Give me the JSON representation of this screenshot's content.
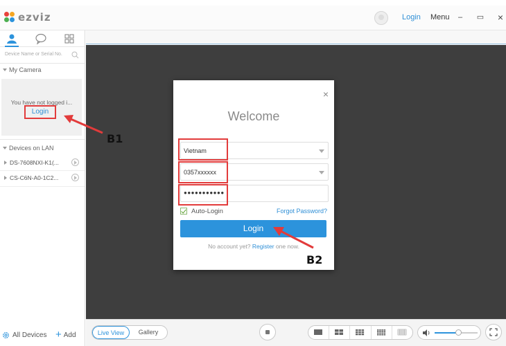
{
  "window": {
    "logo_text": "ezviz",
    "login_label": "Login",
    "menu_label": "Menu",
    "minimize": "–",
    "maximize": "▭",
    "close": "×"
  },
  "sidebar": {
    "search_placeholder": "Device Name or Serial No.",
    "my_camera_label": "My Camera",
    "not_logged_text": "You have not logged i...",
    "login_label": "Login",
    "lan_label": "Devices on LAN",
    "devices": [
      {
        "name": "DS-7608NXI-K1(..."
      },
      {
        "name": "CS-C6N-A0-1C2..."
      }
    ],
    "all_devices_label": "All Devices",
    "add_label": "Add"
  },
  "toolbar": {
    "live_view_label": "Live View",
    "gallery_label": "Gallery"
  },
  "dialog": {
    "close": "×",
    "title": "Welcome",
    "country_value": "Vietnam",
    "phone_value": "0357xxxxxx",
    "password_value": "●●●●●●●●●●●",
    "auto_login_label": "Auto-Login",
    "auto_login_checked": true,
    "forgot_label": "Forgot Password?",
    "login_button": "Login",
    "no_account_text": "No account yet?",
    "register_label": "Register",
    "register_suffix": "one now."
  },
  "annotations": {
    "b1": "B1",
    "b2": "B2"
  },
  "colors": {
    "accent": "#2c93dc",
    "annotation_red": "#e23b3b",
    "viewport": "#3e3e3e"
  }
}
